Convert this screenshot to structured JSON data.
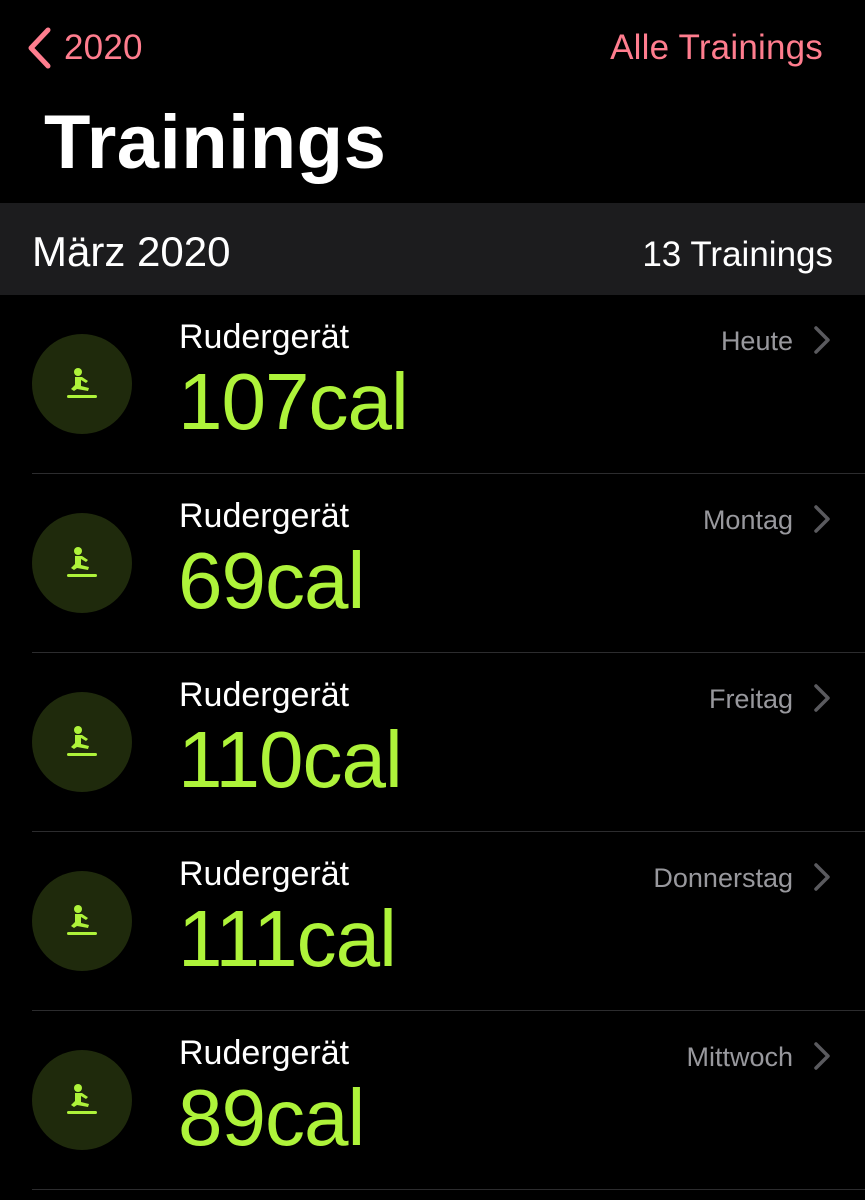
{
  "nav": {
    "back_label": "2020",
    "all_link": "Alle Trainings"
  },
  "title": "Trainings",
  "section": {
    "title": "März 2020",
    "count": "13 Trainings"
  },
  "workouts": [
    {
      "name": "Rudergerät",
      "value": "107cal",
      "day": "Heute"
    },
    {
      "name": "Rudergerät",
      "value": "69cal",
      "day": "Montag"
    },
    {
      "name": "Rudergerät",
      "value": "110cal",
      "day": "Freitag"
    },
    {
      "name": "Rudergerät",
      "value": "111cal",
      "day": "Donnerstag"
    },
    {
      "name": "Rudergerät",
      "value": "89cal",
      "day": "Mittwoch"
    }
  ],
  "colors": {
    "accent": "#FF7D8E",
    "calories": "#AEF33A",
    "icon_bg": "#1F2A0C",
    "section_bg": "#1C1C1E",
    "secondary_text": "#98989D"
  },
  "icons": {
    "back": "chevron-left-icon",
    "row_icon": "rowing-machine-icon",
    "row_chevron": "chevron-right-icon"
  }
}
